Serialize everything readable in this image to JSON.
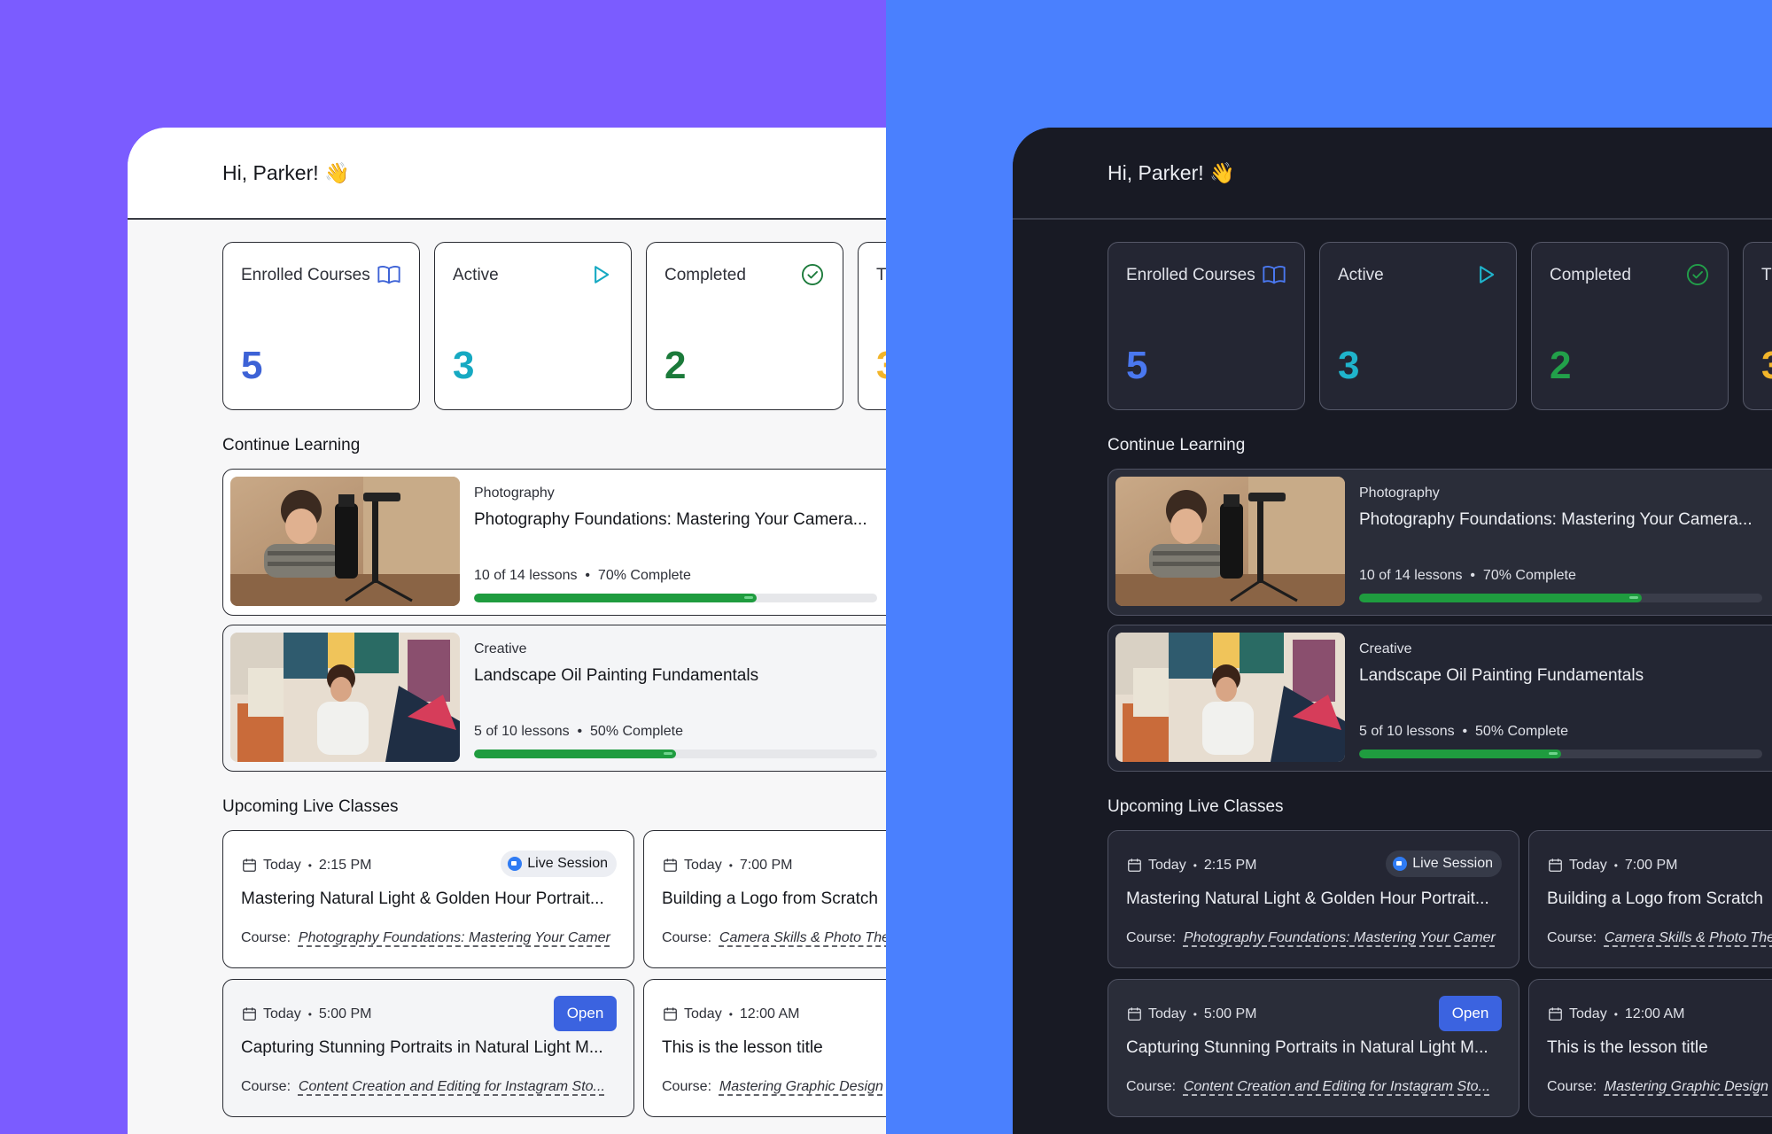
{
  "greeting": "Hi, Parker! 👋",
  "stats": [
    {
      "label": "Enrolled Courses",
      "value": "5",
      "icon": "book-icon",
      "color": "#3d62d6"
    },
    {
      "label": "Active",
      "value": "3",
      "icon": "play-icon",
      "color": "#16a9c2"
    },
    {
      "label": "Completed",
      "value": "2",
      "icon": "check-circle-icon",
      "color": "#1b7a3a"
    },
    {
      "label": "T",
      "value": "3",
      "color": "#f2b52a"
    }
  ],
  "continue_learning": {
    "heading": "Continue Learning",
    "courses": [
      {
        "category": "Photography",
        "title": "Photography Foundations: Mastering Your Camera...",
        "lessons": "10 of 14 lessons",
        "complete": "70% Complete",
        "progress": 0.7
      },
      {
        "category": "Creative",
        "title": "Landscape Oil Painting Fundamentals",
        "lessons": "5 of 10 lessons",
        "complete": "50% Complete",
        "progress": 0.5
      }
    ]
  },
  "upcoming": {
    "heading": "Upcoming Live Classes",
    "course_prefix": "Course:",
    "live_badge": "Live Session",
    "open_label": "Open",
    "classes": [
      {
        "day": "Today",
        "time": "2:15 PM",
        "title": "Mastering Natural Light & Golden Hour Portrait...",
        "course": "Photography Foundations: Mastering Your Camer"
      },
      {
        "day": "Today",
        "time": "7:00 PM",
        "title": "Building a Logo from Scratch",
        "course": "Camera Skills & Photo The"
      },
      {
        "day": "Today",
        "time": "5:00 PM",
        "title": "Capturing Stunning Portraits in Natural Light M...",
        "course": "Content Creation and Editing for Instagram Sto..."
      },
      {
        "day": "Today",
        "time": "12:00 AM",
        "title": "This is the lesson title",
        "course": "Mastering Graphic Design"
      }
    ]
  },
  "colors": {
    "left_bg": "#7b5cff",
    "right_bg": "#4a80fe",
    "progress": "#1f9c3f",
    "open_button": "#3b63e0"
  }
}
